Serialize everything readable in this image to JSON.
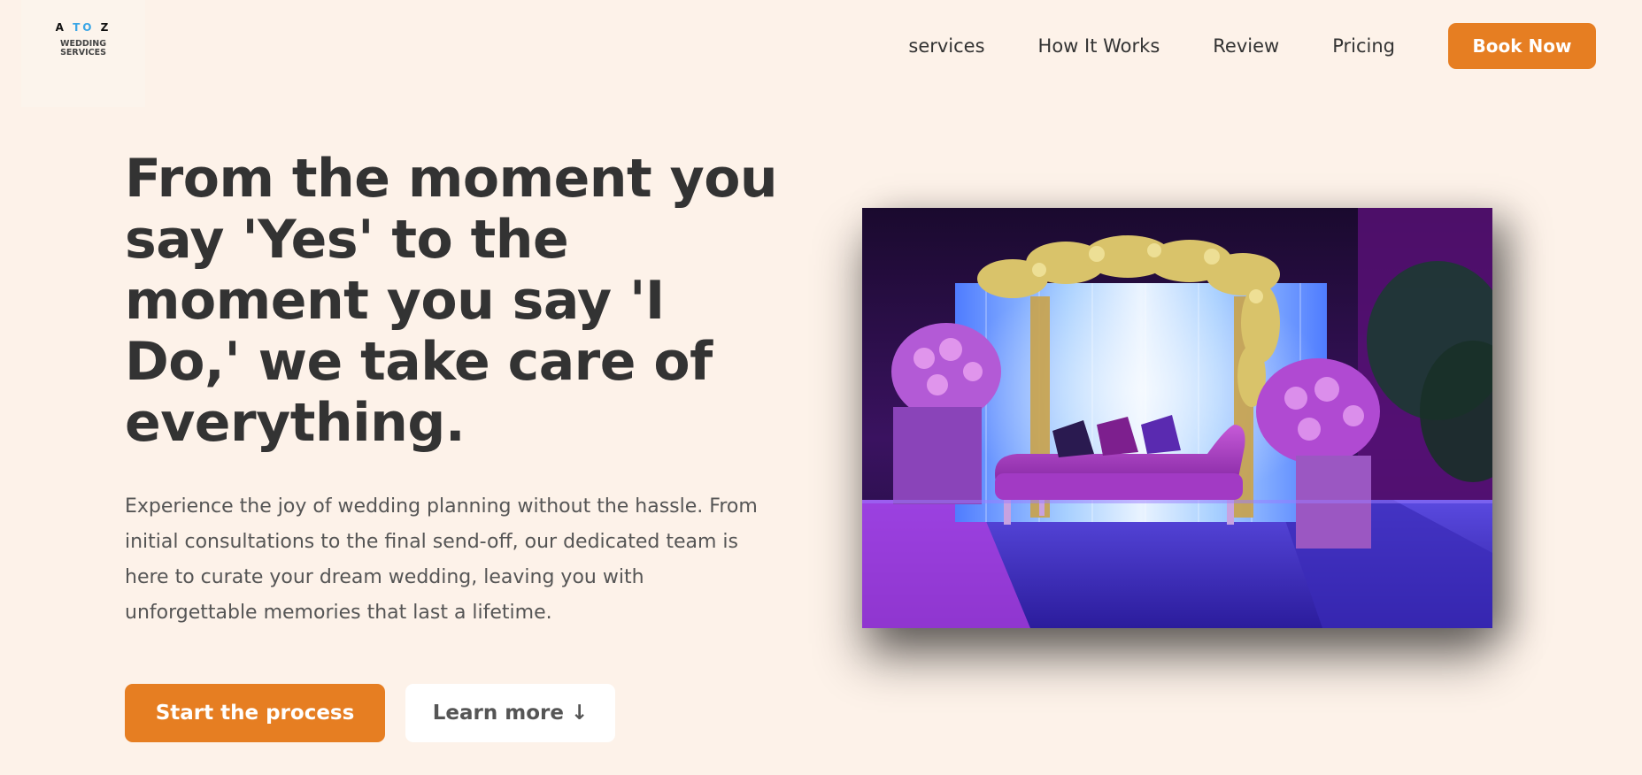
{
  "logo": {
    "letter_a": "A",
    "letter_to": "TO",
    "letter_z": "Z",
    "line1": "WEDDING",
    "line2": "SERVICES"
  },
  "nav": {
    "items": [
      {
        "label": "services"
      },
      {
        "label": "How It Works"
      },
      {
        "label": "Review"
      },
      {
        "label": "Pricing"
      }
    ],
    "cta_label": "Book Now"
  },
  "hero": {
    "title": "From the moment you say 'Yes' to the moment you say 'I Do,' we take care of everything.",
    "description": "Experience the joy of wedding planning without the hassle. From initial consultations to the final send-off, our dedicated team is here to curate your dream wedding, leaving you with unforgettable memories that last a lifetime.",
    "primary_cta": "Start the process",
    "secondary_cta": "Learn more ↓"
  },
  "colors": {
    "background": "#fdf2e9",
    "accent": "#e67e22",
    "text": "#333333",
    "logo_to": "#3aa6e6"
  }
}
